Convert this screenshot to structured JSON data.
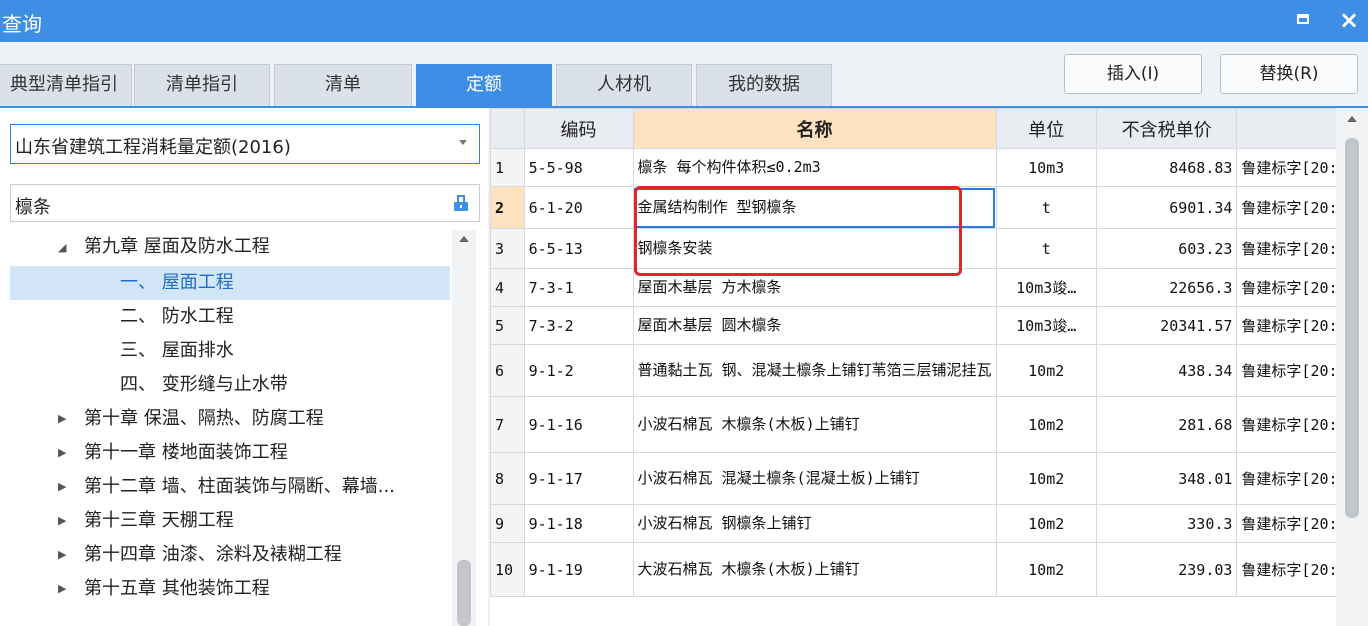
{
  "window": {
    "title": "查询"
  },
  "tabs": [
    {
      "label": "典型清单指引",
      "active": false
    },
    {
      "label": "清单指引",
      "active": false
    },
    {
      "label": "清单",
      "active": false
    },
    {
      "label": "定额",
      "active": true
    },
    {
      "label": "人材机",
      "active": false
    },
    {
      "label": "我的数据",
      "active": false
    }
  ],
  "buttons": {
    "insert": "插入(I)",
    "replace": "替换(R)"
  },
  "left_panel": {
    "library": "山东省建筑工程消耗量定额(2016)",
    "search_value": "檩条",
    "tree": [
      {
        "label": "第九章 屋面及防水工程",
        "expanded": true
      },
      {
        "label": "一、 屋面工程",
        "selected": true
      },
      {
        "label": "二、 防水工程"
      },
      {
        "label": "三、 屋面排水"
      },
      {
        "label": "四、 变形缝与止水带"
      },
      {
        "label": "第十章 保温、隔热、防腐工程"
      },
      {
        "label": "第十一章 楼地面装饰工程"
      },
      {
        "label": "第十二章 墙、柱面装饰与隔断、幕墙..."
      },
      {
        "label": "第十三章 天棚工程"
      },
      {
        "label": "第十四章 油漆、涂料及裱糊工程"
      },
      {
        "label": "第十五章 其他装饰工程"
      }
    ]
  },
  "grid": {
    "columns": [
      "编码",
      "名称",
      "单位",
      "不含税单价",
      "来"
    ],
    "rows": [
      {
        "n": "1",
        "code": "5-5-98",
        "name": "檩条 每个构件体积≤0.2m3",
        "unit": "10m3",
        "price": "8468.83",
        "src": "鲁建标字[20:"
      },
      {
        "n": "2",
        "code": "6-1-20",
        "name": "金属结构制作 型钢檩条",
        "unit": "t",
        "price": "6901.34",
        "src": "鲁建标字[20:"
      },
      {
        "n": "3",
        "code": "6-5-13",
        "name": "钢檩条安装",
        "unit": "t",
        "price": "603.23",
        "src": "鲁建标字[20:"
      },
      {
        "n": "4",
        "code": "7-3-1",
        "name": "屋面木基层 方木檩条",
        "unit": "10m3竣…",
        "price": "22656.3",
        "src": "鲁建标字[20:"
      },
      {
        "n": "5",
        "code": "7-3-2",
        "name": "屋面木基层 圆木檩条",
        "unit": "10m3竣…",
        "price": "20341.57",
        "src": "鲁建标字[20:"
      },
      {
        "n": "6",
        "code": "9-1-2",
        "name": "普通黏土瓦 钢、混凝土檩条上铺钉苇箔三层铺泥挂瓦",
        "unit": "10m2",
        "price": "438.34",
        "src": "鲁建标字[20:"
      },
      {
        "n": "7",
        "code": "9-1-16",
        "name": "小波石棉瓦 木檩条(木板)上铺钉",
        "unit": "10m2",
        "price": "281.68",
        "src": "鲁建标字[20:"
      },
      {
        "n": "8",
        "code": "9-1-17",
        "name": "小波石棉瓦 混凝土檩条(混凝土板)上铺钉",
        "unit": "10m2",
        "price": "348.01",
        "src": "鲁建标字[20:"
      },
      {
        "n": "9",
        "code": "9-1-18",
        "name": "小波石棉瓦 钢檩条上铺钉",
        "unit": "10m2",
        "price": "330.3",
        "src": "鲁建标字[20:"
      },
      {
        "n": "10",
        "code": "9-1-19",
        "name": "大波石棉瓦 木檩条(木板)上铺钉",
        "unit": "10m2",
        "price": "239.03",
        "src": "鲁建标字[20:"
      }
    ]
  },
  "colors": {
    "accent": "#3d8ee4",
    "selection": "#d3e6f8",
    "header_highlight": "#fde2c0",
    "annotation": "#e0262a"
  }
}
